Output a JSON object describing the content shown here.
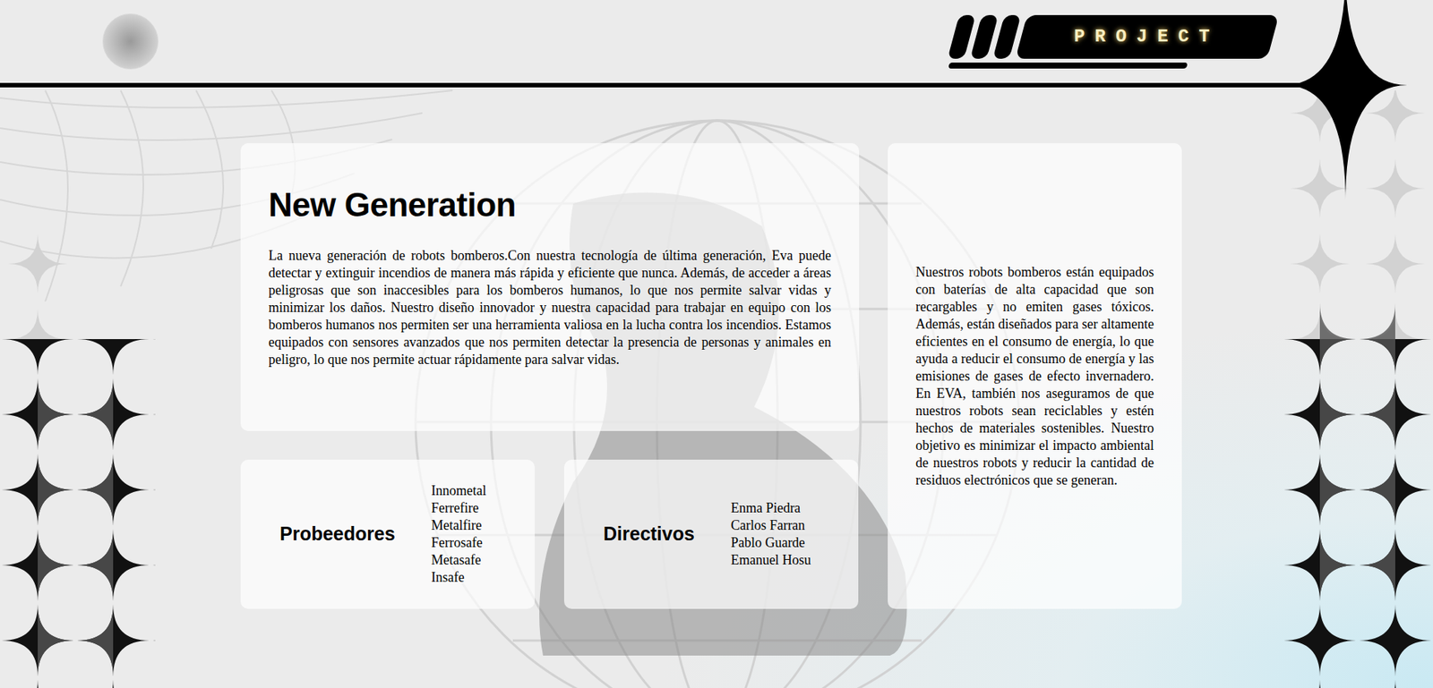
{
  "header": {
    "badge": "PROJECT"
  },
  "intro": {
    "title": "New Generation",
    "body": "La nueva generación de robots bomberos.Con nuestra tecnología de última generación, Eva puede detectar y extinguir incendios de manera más rápida y eficiente que nunca. Además, de acceder a áreas peligrosas que son inaccesibles para los bomberos humanos, lo que nos permite salvar vidas y minimizar los daños. Nuestro diseño innovador y nuestra capacidad para trabajar en equipo con los bomberos humanos nos permiten ser una herramienta valiosa en la lucha contra los incendios. Estamos equipados con sensores avanzados que nos permiten detectar la presencia de personas y animales en peligro, lo que nos permite actuar rápidamente para salvar vidas."
  },
  "sustainability": {
    "body": "Nuestros robots bomberos están equipados con baterías de alta capacidad que son recargables y no emiten gases tóxicos. Además, están diseñados para ser altamente eficientes en el consumo de energía, lo que ayuda a reducir el consumo de energía y las emisiones de gases de efecto invernadero. En EVA, también nos aseguramos de que nuestros robots sean reciclables y estén hechos de materiales sostenibles. Nuestro objetivo es minimizar el impacto ambiental de nuestros robots y reducir la cantidad de residuos electrónicos que se generan."
  },
  "suppliers": {
    "title": "Probeedores",
    "items": [
      "Innometal",
      "Ferrefire",
      "Metalfire",
      "Ferrosafe",
      "Metasafe",
      "Insafe"
    ]
  },
  "directors": {
    "title": "Directivos",
    "items": [
      "Enma Piedra",
      "Carlos Farran",
      "Pablo Guarde",
      "Emanuel Hosu"
    ]
  }
}
